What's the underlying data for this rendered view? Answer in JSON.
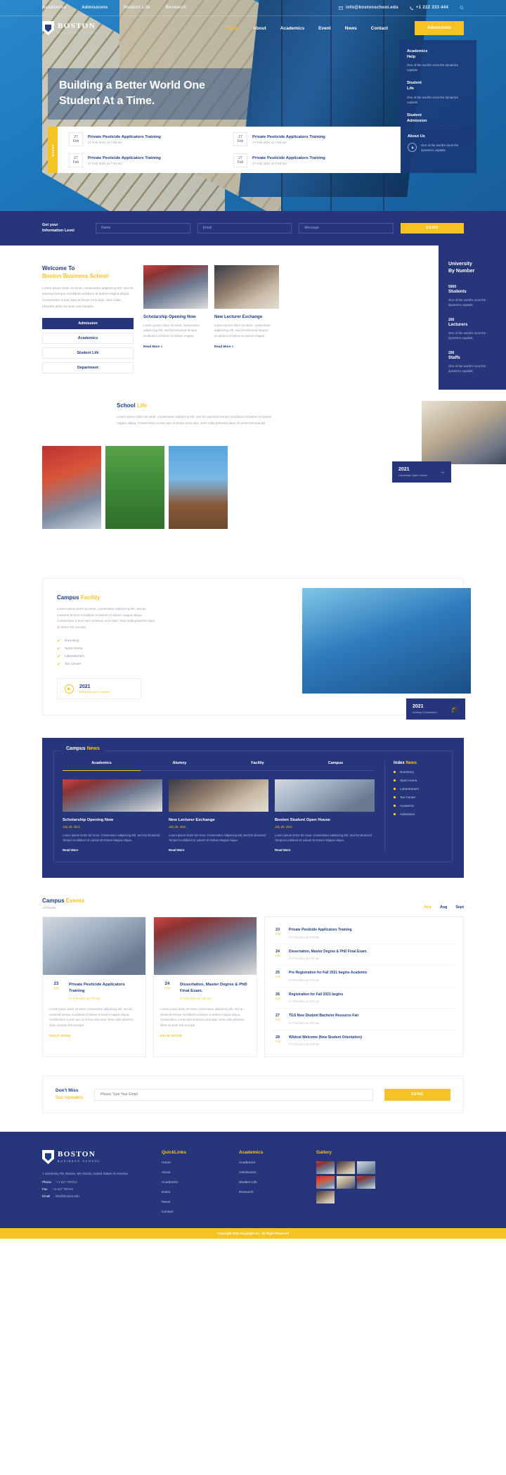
{
  "topbar": {
    "links": [
      "Academics",
      "Admissions",
      "Student Life",
      "Research"
    ],
    "email": "info@bostonschool.edu",
    "phone": "+1 222 333 444",
    "email_icon": "envelope-icon",
    "phone_icon": "phone-icon",
    "search_icon": "search-icon"
  },
  "brand": {
    "name": "BOSTON",
    "tagline": "BUSINESS SCHOOL"
  },
  "nav": {
    "items": [
      "Home",
      "About",
      "Academics",
      "Event",
      "News",
      "Contact"
    ],
    "active": "Home",
    "cta": "Admissions"
  },
  "hero": {
    "title": "Building a Better World One Student At a Time.",
    "cards": [
      {
        "title": "Academics\nHelp",
        "text": "One of the world's most the dynamics capitals"
      },
      {
        "title": "Student\nLife",
        "text": "One of the world's most the dynamics capitals"
      },
      {
        "title": "Student\nAdmission",
        "text": "One of the world's most the dynamics capitals"
      }
    ],
    "events_tab": "EVENT",
    "events": [
      {
        "day": "27",
        "month": "Feb",
        "title": "Private Pesticide Applicators Training",
        "date": "27 Feb 2021 at 7:00 am"
      },
      {
        "day": "27",
        "month": "Feb",
        "title": "Private Pesticide Applicators Training",
        "date": "27 Feb 2021 at 7:00 am"
      },
      {
        "day": "27",
        "month": "Feb",
        "title": "Private Pesticide Applicators Training",
        "date": "27 Feb 2021 at 7:00 am"
      },
      {
        "day": "27",
        "month": "Feb",
        "title": "Private Pesticide Applicators Training",
        "date": "27 Feb 2021 at 7:00 am"
      }
    ],
    "about": {
      "title": "About Us",
      "text": "One of the world's most the dynamics capitals",
      "icon": "play-icon"
    }
  },
  "infobar": {
    "label": "Get your\nInformation Level",
    "name_placeholder": "Name",
    "email_placeholder": "Email",
    "message_placeholder": "Message",
    "send": "SEND"
  },
  "welcome": {
    "small": "Welcome To",
    "title": "Boston Business School",
    "text": "Lorem ipsum dolor sit amet, consectetur adipiscing elit, sed do eiusmod tempor incididunt ut labore et dolore magna aliqua. Consectetur a erat nam at lectus urna duis. Sem nulla pharetra diam sit amet nisl suscipit.",
    "menu": [
      "Admission",
      "Academics",
      "Student Life",
      "Department"
    ],
    "menu_active": "Admission",
    "cards": [
      {
        "title": "Scholarship Opening Now",
        "text": "Lorem ipsum dolor sit amet, consectetur adipiscing elit, sed do eiusmod tempor incididunt ut labore et dolore magna",
        "more": "Read More »"
      },
      {
        "title": "New Lecturer Exchange",
        "text": "Lorem ipsum dolor sit amet, consectetur adipiscing elit, sed do eiusmod tempor incididunt ut labore et dolore magna",
        "more": "Read More »"
      }
    ]
  },
  "numbers": {
    "title": "University\nBy Number",
    "stats": [
      {
        "value": "5000",
        "label": "Students",
        "text": "One of the world's most the dynamics capitals"
      },
      {
        "value": "200",
        "label": "Lecturers",
        "text": "One of the world's most the dynamics capitals"
      },
      {
        "value": "200",
        "label": "Staffs",
        "text": "One of the world's most the dynamics capitals"
      }
    ]
  },
  "school_life": {
    "title_1": "School",
    "title_2": "Life",
    "text": "Lorem ipsum dolor sit amet, consectetur adipiscing elit, sed do eiusmod tempor incididunt ut labore et dolore magna aliqua. Consectetur a erat nam at lectus urna duis. Sem nulla pharetra diam sit amet nisl suscipit.",
    "badge": {
      "year": "2021",
      "label": "University Open House",
      "arrow": "→"
    }
  },
  "facility": {
    "title_1": "Campus",
    "title_2": "Facility",
    "text": "Lorem ipsum dolor sit amet, consectetur adipiscing elit, sed do eiusmod tempor incididunt ut labore et dolore magna aliqua. Consectetur a erat nam at lectus urna duis. Sem nulla pharetra diam sit amet nisl suscipit.",
    "items": [
      "Dormitory",
      "Sport Arena",
      "Laboratorium",
      "Tax Center"
    ],
    "check_icon": "check-icon",
    "badge": {
      "year": "2021",
      "label": "University Better Facility",
      "icon": "play-icon"
    },
    "badge2": {
      "year": "2021",
      "label": "Alumny Connection",
      "icon": "graduation-cap-icon"
    }
  },
  "news": {
    "title_1": "Campus",
    "title_2": "News",
    "tabs": [
      "Academics",
      "Alumny",
      "Facility",
      "Campus"
    ],
    "tab_active": "Academics",
    "items": [
      {
        "title": "Scholarship Opening Now",
        "date": "July 26, 2021",
        "text": "Lorem ipsum Dolor Sit Amet. Consectetur Adipiscing Elit, Sed Do Eiusmod Tempor Incididunt Ut Labore Et Dolore Magna Aliqua.",
        "more": "Read More"
      },
      {
        "title": "New Lecturer Exchange",
        "date": "July 26, 2021",
        "text": "Lorem ipsum Dolor Sit Amet. Consectetur Adipiscing Elit, Sed Do Eiusmod Tempor Incididunt Ut Labore Et Dolore Magna Aliqua.",
        "more": "Read More"
      },
      {
        "title": "Boston Student Open House",
        "date": "July 26, 2021",
        "text": "Lorem ipsum Dolor Sit Amet. Consectetur Adipiscing Elit, Sed Do Eiusmod Tempor Incididunt Ut Labore Et Dolore Magna Aliqua.",
        "more": "Read More"
      }
    ],
    "index_title_1": "Index",
    "index_title_2": "News",
    "index": [
      "Dormitory",
      "Sport Arena",
      "Laboratorium",
      "Tax Center",
      "Academic",
      "Admission"
    ]
  },
  "campus_events": {
    "title_1": "Campus",
    "title_2": "Events",
    "subtitle": "All Events",
    "months": [
      "July",
      "Aug",
      "Sept"
    ],
    "month_active": "July",
    "cards": [
      {
        "day": "23",
        "month": "July",
        "title": "Private Pesticide Applicators Training",
        "date": "27 Feb 2021 at 7:00 am",
        "text": "Lorem ipsum dolor sit amet, consectetur adipiscing elit, sed do eiusmod tempor incididunt ut labore et dolore magna aliqua. Consectetur a erat nam at lectus urna duis. Sem nulla pharetra diam sit amet nisl suscipit.",
        "more": "READ MORE"
      },
      {
        "day": "24",
        "month": "July",
        "title": "Dissertation, Master Degree & PhD Final Exam.",
        "date": "27 Feb 2021 at 7:00 am",
        "text": "Lorem ipsum dolor sit amet, consectetur adipiscing elit, sed do eiusmod tempor incididunt ut labore et dolore magna aliqua. Consectetur a erat nam at lectus urna duis. Sem nulla pharetra diam sit amet nisl suscipit.",
        "more": "READ MORE"
      }
    ],
    "list": [
      {
        "day": "23",
        "month": "July",
        "title": "Private Pesticide Applicators Training",
        "date": "27 Feb 2021 at 7:00 am"
      },
      {
        "day": "24",
        "month": "July",
        "title": "Dissertation, Master Degree & PhD Final Exam.",
        "date": "27 Feb 2021 at 7:00 am"
      },
      {
        "day": "25",
        "month": "July",
        "title": "Pre Registration for Fall 2021 begins Academic",
        "date": "27 Feb 2021 at 7:00 am"
      },
      {
        "day": "26",
        "month": "July",
        "title": "Registration for Fall 2021 begins",
        "date": "27 Feb 2021 at 7:00 am"
      },
      {
        "day": "27",
        "month": "July",
        "title": "TGS New Student Bachelor Resource Fair",
        "date": "27 Feb 2021 at 7:00 am"
      },
      {
        "day": "28",
        "month": "July",
        "title": "Wildcat Welcome (New Student Orientation)",
        "date": "27 Feb 2021 at 7:00 am"
      }
    ]
  },
  "newsletter": {
    "line1": "Don't Miss",
    "line2": "Our Updates",
    "placeholder": "Please Type Your Email",
    "button": "SEND"
  },
  "footer": {
    "brand": "BOSTON",
    "tagline": "BUSINESS SCHOOL",
    "address": "1 University Rd, Boston, MA 02215, United States of America",
    "contacts": [
      {
        "key": "Phone",
        "value": ": +1 617 787/14"
      },
      {
        "key": "Fax",
        "value": ": +1 617 787/14"
      },
      {
        "key": "Email",
        "value": ": info@boston.edu"
      }
    ],
    "columns": [
      {
        "title": "QuickLinks",
        "links": [
          "Home",
          "About",
          "Academics",
          "Event",
          "News",
          "Contact"
        ]
      },
      {
        "title": "Academics",
        "links": [
          "Academics",
          "Admissions",
          "Student Life",
          "Research"
        ]
      }
    ],
    "gallery_title": "Gallery",
    "gallery_count": 7,
    "copyright": "Copyright 2021 Kingsight Inc. All Right Reserved"
  },
  "colors": {
    "brand_blue": "#27357a",
    "accent_yellow": "#f6c324",
    "deep_blue": "#1d3c84"
  }
}
